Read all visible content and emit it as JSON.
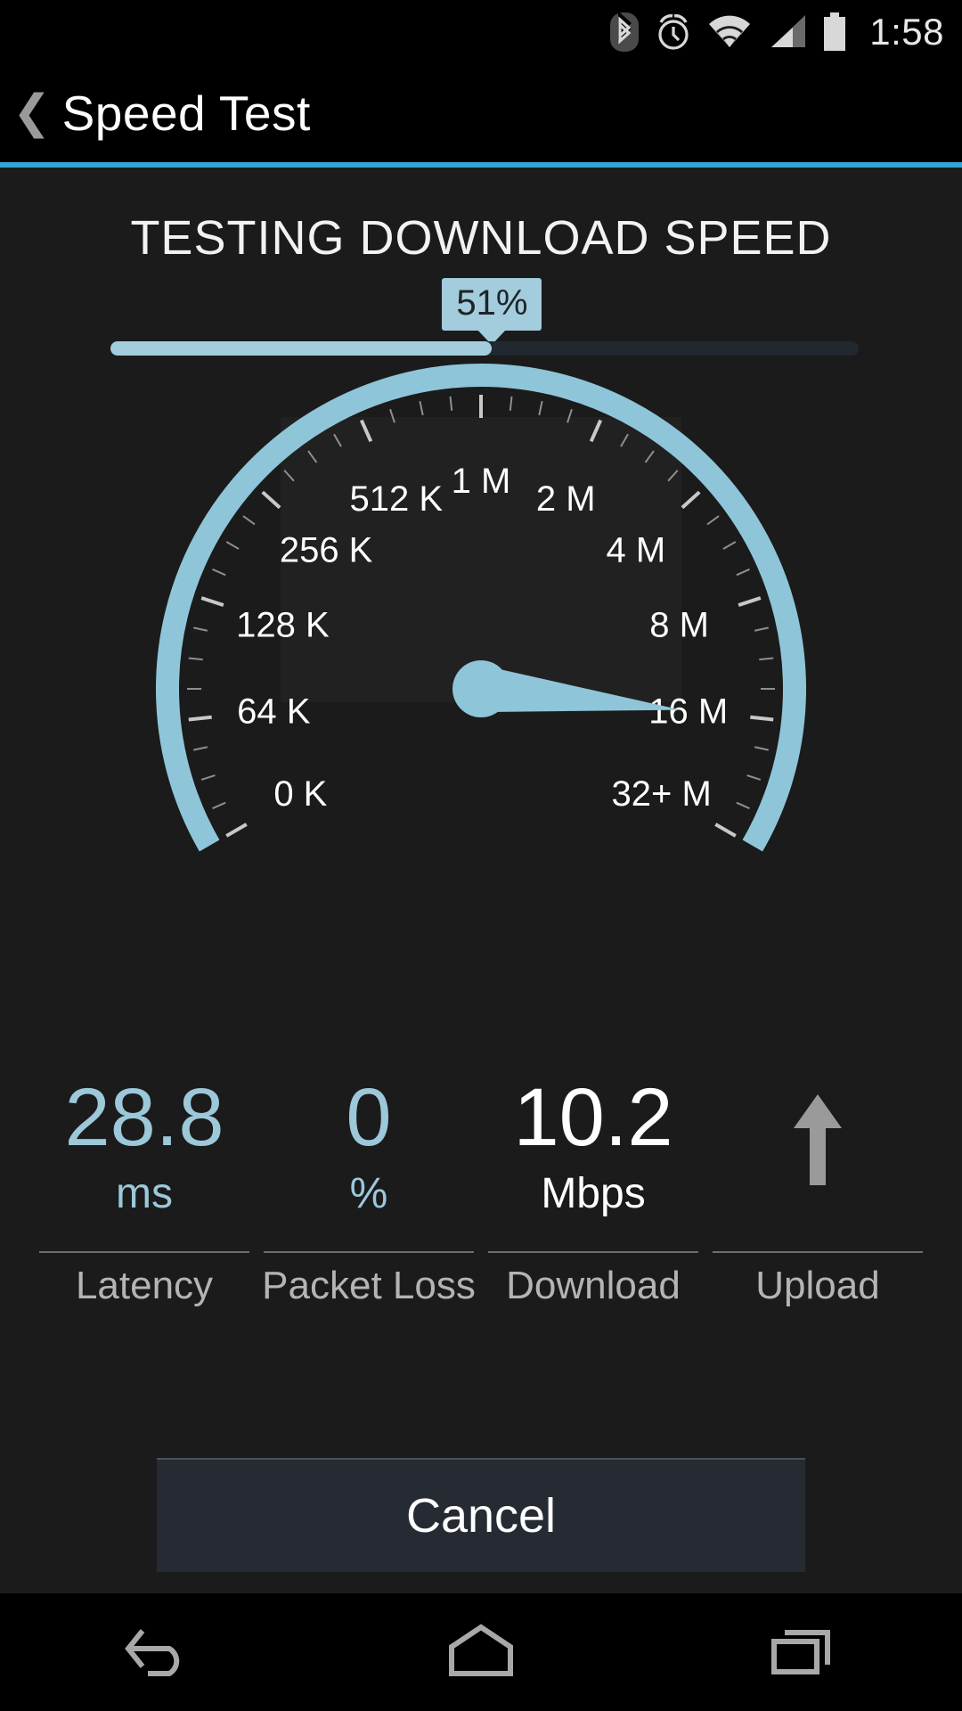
{
  "statusbar": {
    "time": "1:58",
    "icons": [
      "bluetooth-icon",
      "alarm-icon",
      "wifi-icon",
      "cellular-signal-icon",
      "battery-icon"
    ]
  },
  "appbar": {
    "back_label": "❮",
    "title": "Speed Test",
    "accent_color": "#31a8d4"
  },
  "test": {
    "title": "TESTING DOWNLOAD SPEED",
    "progress_label": "51%",
    "progress_percent": 51
  },
  "gauge": {
    "labels": [
      "0 K",
      "64 K",
      "128 K",
      "256 K",
      "512 K",
      "1 M",
      "2 M",
      "4 M",
      "8 M",
      "16 M",
      "32+ M"
    ],
    "needle_value": "16 M",
    "arc_color": "#8fc5d9",
    "needle_color": "#8fc5d9"
  },
  "stats": [
    {
      "value": "28.8",
      "unit": "ms",
      "label": "Latency",
      "tone": "blue"
    },
    {
      "value": "0",
      "unit": "%",
      "label": "Packet Loss",
      "tone": "blue"
    },
    {
      "value": "10.2",
      "unit": "Mbps",
      "label": "Download",
      "tone": "white"
    },
    {
      "value": "",
      "unit": "",
      "label": "Upload",
      "tone": "icon",
      "icon": "up-arrow-icon"
    }
  ],
  "actions": {
    "cancel_label": "Cancel"
  },
  "navbar": {
    "back": "back-icon",
    "home": "home-icon",
    "recents": "recents-icon"
  },
  "chart_data": {
    "type": "gauge",
    "title": "TESTING DOWNLOAD SPEED",
    "scale_labels": [
      "0 K",
      "64 K",
      "128 K",
      "256 K",
      "512 K",
      "1 M",
      "2 M",
      "4 M",
      "8 M",
      "16 M",
      "32+ M"
    ],
    "needle_points_at": "16 M",
    "current_download_mbps": 10.2,
    "progress_percent": 51,
    "metrics": {
      "latency_ms": 28.8,
      "packet_loss_pct": 0,
      "download_mbps": 10.2,
      "upload_mbps": null
    }
  }
}
